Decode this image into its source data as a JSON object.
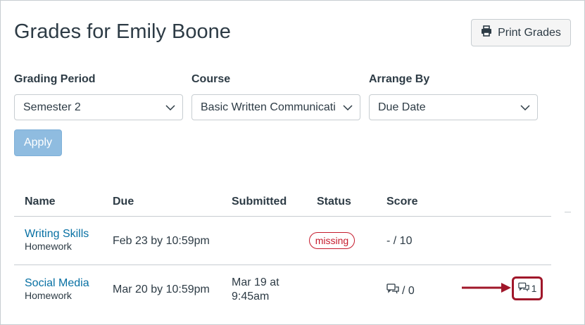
{
  "page": {
    "title": "Grades for Emily Boone",
    "print_label": "Print Grades"
  },
  "filters": {
    "grading_period": {
      "label": "Grading Period",
      "value": "Semester 2"
    },
    "course": {
      "label": "Course",
      "value": "Basic Written Communication"
    },
    "arrange_by": {
      "label": "Arrange By",
      "value": "Due Date"
    },
    "apply_label": "Apply"
  },
  "table": {
    "headers": {
      "name": "Name",
      "due": "Due",
      "submitted": "Submitted",
      "status": "Status",
      "score": "Score"
    },
    "rows": [
      {
        "name": "Writing Skills",
        "type": "Homework",
        "due": "Feb 23 by 10:59pm",
        "submitted": "",
        "status": "missing",
        "score": "- / 10",
        "comments": ""
      },
      {
        "name": "Social Media",
        "type": "Homework",
        "due": "Mar 20 by 10:59pm",
        "submitted_line1": "Mar 19 at",
        "submitted_line2": "9:45am",
        "status": "",
        "score": "/ 0",
        "comments": "1"
      }
    ]
  },
  "colors": {
    "link": "#0770a3",
    "missing": "#c51a2c",
    "annotation": "#a0172a",
    "apply": "#8fbce0"
  },
  "icons": {
    "print": "printer-icon",
    "chevron": "chevron-down-icon",
    "comment": "comment-icon",
    "arrow": "annotation-arrow"
  }
}
